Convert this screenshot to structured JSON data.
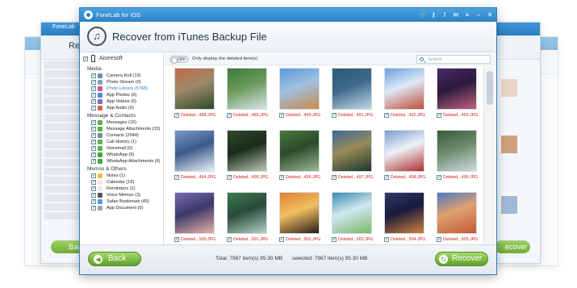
{
  "window": {
    "title": "FoneLab for iOS"
  },
  "header": {
    "title": "Recover from iTunes Backup File"
  },
  "background": {
    "left_title": "FoneLab",
    "left_heading": "Rec",
    "left_back": "Bac",
    "right_recover": "ecover"
  },
  "sidebar": {
    "device": "Aiseesoft",
    "sections": [
      {
        "title": "Media",
        "items": [
          {
            "label": "Camera Roll (19)",
            "color": "#6b8fb3"
          },
          {
            "label": "Photo Stream (0)",
            "color": "#8aa1b8"
          },
          {
            "label": "Photo Library (5768)",
            "color": "#c95b8c",
            "selected": true
          },
          {
            "label": "App Photos (0)",
            "color": "#4c8fd0"
          },
          {
            "label": "App Videos (0)",
            "color": "#7f6fc4"
          },
          {
            "label": "App Audio (0)",
            "color": "#e0604f"
          }
        ]
      },
      {
        "title": "Message & Contacts",
        "items": [
          {
            "label": "Messages (15)",
            "color": "#59b34a"
          },
          {
            "label": "Message Attachments (15)",
            "color": "#59b34a"
          },
          {
            "label": "Contacts (2044)",
            "color": "#7d8b96"
          },
          {
            "label": "Call History (1)",
            "color": "#59b34a"
          },
          {
            "label": "Voicemail (0)",
            "color": "#59b34a"
          },
          {
            "label": "WhatsApp (9)",
            "color": "#3ea842"
          },
          {
            "label": "WhatsApp Attachments (9)",
            "color": "#3ea842"
          }
        ]
      },
      {
        "title": "Memos & Others",
        "items": [
          {
            "label": "Notes (1)",
            "color": "#e9c23a"
          },
          {
            "label": "Calendar (18)",
            "color": "#e9e9e9"
          },
          {
            "label": "Reminders (2)",
            "color": "#e9e9e9"
          },
          {
            "label": "Voice Memos (3)",
            "color": "#555555"
          },
          {
            "label": "Safari Bookmark (49)",
            "color": "#4d9be0"
          },
          {
            "label": "App Document (0)",
            "color": "#9aa6b0"
          }
        ]
      }
    ]
  },
  "toolbar": {
    "toggle_state": "OFF",
    "toggle_label": "Only display the deleted item(s)",
    "search_placeholder": "Search"
  },
  "photos": [
    {
      "caption": "Deleted...488.JPG",
      "colors": [
        "#c46a4a",
        "#2f4b2a",
        "#9c8a6a"
      ]
    },
    {
      "caption": "Deleted...489.JPG",
      "colors": [
        "#3f7a3a",
        "#d8e4ea",
        "#6a9a5a"
      ]
    },
    {
      "caption": "Deleted...490.JPG",
      "colors": [
        "#5a9ad8",
        "#c88a4a",
        "#a0c0e0"
      ]
    },
    {
      "caption": "Deleted...491.JPG",
      "colors": [
        "#2a5a7a",
        "#c0d8e8",
        "#406a8a"
      ]
    },
    {
      "caption": "Deleted...492.JPG",
      "colors": [
        "#6aa0e0",
        "#c04a3a",
        "#dfe9f5"
      ]
    },
    {
      "caption": "Deleted...493.JPG",
      "colors": [
        "#4a2a6a",
        "#c06080",
        "#2a1a3a"
      ]
    },
    {
      "caption": "Deleted...494.JPG",
      "colors": [
        "#7a9ac8",
        "#e8f0f8",
        "#3a5a8a"
      ]
    },
    {
      "caption": "Deleted...495.JPG",
      "colors": [
        "#2f4a2a",
        "#b8c8b0",
        "#1a2a1a"
      ]
    },
    {
      "caption": "Deleted...496.JPG",
      "colors": [
        "#4a7a3a",
        "#9ab890",
        "#2a4a2a"
      ]
    },
    {
      "caption": "Deleted...497.JPG",
      "colors": [
        "#3a6a9a",
        "#1a3a2a",
        "#9a8a5a"
      ]
    },
    {
      "caption": "Deleted...498.JPG",
      "colors": [
        "#7aa0d0",
        "#b03030",
        "#eef2f6"
      ]
    },
    {
      "caption": "Deleted...499.JPG",
      "colors": [
        "#3a5a3a",
        "#d0dce0",
        "#6a8a6a"
      ]
    },
    {
      "caption": "Deleted...500.JPG",
      "colors": [
        "#7a6ab0",
        "#e8b0a0",
        "#3a3a6a"
      ]
    },
    {
      "caption": "Deleted...501.JPG",
      "colors": [
        "#3a7a4a",
        "#b0d0c0",
        "#2a4a3a"
      ]
    },
    {
      "caption": "Deleted...502.JPG",
      "colors": [
        "#e08030",
        "#2a1a1a",
        "#f0c060"
      ]
    },
    {
      "caption": "Deleted...503.JPG",
      "colors": [
        "#3a8ab0",
        "#7ab86a",
        "#d0e8f0"
      ]
    },
    {
      "caption": "Deleted...504.JPG",
      "colors": [
        "#2a3a6a",
        "#d08040",
        "#1a1a3a"
      ]
    },
    {
      "caption": "Deleted...505.JPG",
      "colors": [
        "#4a7ac0",
        "#c05a3a",
        "#e0a070"
      ]
    }
  ],
  "footer": {
    "back_label": "Back",
    "recover_label": "Recover",
    "total": "Total: 7967 item(s) 95.30 MB",
    "selected": "selected: 7967 item(s) 95.30 MB"
  }
}
